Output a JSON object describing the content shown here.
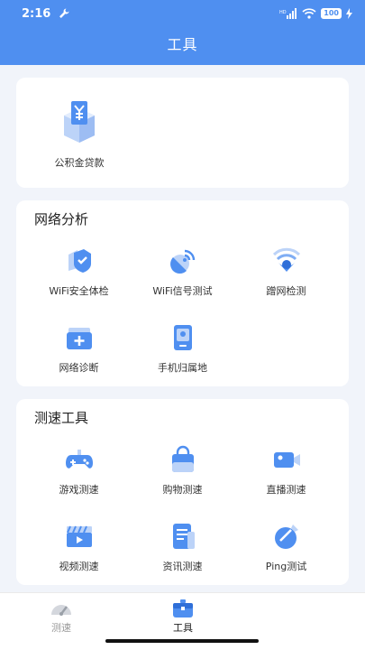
{
  "status_bar": {
    "time": "2:16",
    "battery": "100"
  },
  "header": {
    "title": "工具"
  },
  "loan_card": {
    "item_label": "公积金贷款",
    "icon": "building-yen-icon"
  },
  "network": {
    "title": "网络分析",
    "items": [
      {
        "label": "WiFi安全体检",
        "icon": "shield-check-icon"
      },
      {
        "label": "WiFi信号测试",
        "icon": "signal-dish-icon"
      },
      {
        "label": "蹭网检测",
        "icon": "wifi-detect-icon"
      },
      {
        "label": "网络诊断",
        "icon": "medical-kit-icon"
      },
      {
        "label": "手机归属地",
        "icon": "phone-location-icon"
      }
    ]
  },
  "speed": {
    "title": "测速工具",
    "items": [
      {
        "label": "游戏测速",
        "icon": "gamepad-icon"
      },
      {
        "label": "购物测速",
        "icon": "shopping-bag-icon"
      },
      {
        "label": "直播测速",
        "icon": "video-camera-icon"
      },
      {
        "label": "视频测速",
        "icon": "clapperboard-icon"
      },
      {
        "label": "资讯测速",
        "icon": "news-icon"
      },
      {
        "label": "Ping测试",
        "icon": "ping-icon"
      }
    ]
  },
  "tabbar": {
    "tabs": [
      {
        "label": "测速",
        "icon": "speedometer-icon",
        "active": false
      },
      {
        "label": "工具",
        "icon": "toolbox-icon",
        "active": true
      }
    ]
  },
  "colors": {
    "brand": "#4f8ff0",
    "background": "#f1f4fa"
  }
}
